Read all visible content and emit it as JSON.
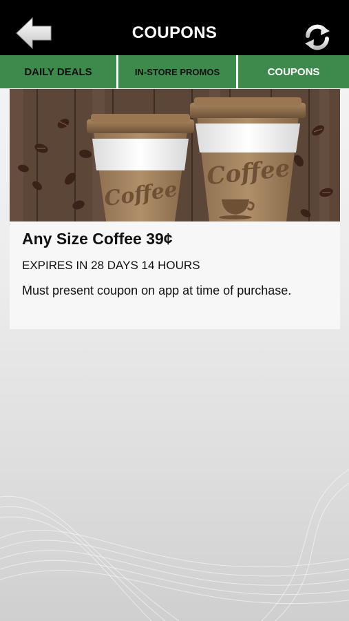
{
  "header": {
    "title": "COUPONS",
    "back_icon": "back-arrow-icon",
    "refresh_icon": "refresh-icon"
  },
  "tabs": [
    {
      "label": "DAILY DEALS",
      "active": false
    },
    {
      "label": "IN-STORE PROMOS",
      "active": false
    },
    {
      "label": "COUPONS",
      "active": true
    }
  ],
  "coupon": {
    "image_text": [
      "Coffee",
      "Coffee"
    ],
    "title": "Any Size Coffee 39¢",
    "expires": "EXPIRES IN 28 DAYS 14 HOURS",
    "description": "Must present coupon on app at time of purchase."
  },
  "colors": {
    "topbar": "#000000",
    "tab": "#3e8a4d",
    "active_tab_text": "#ffffff",
    "tab_text": "#111111"
  }
}
